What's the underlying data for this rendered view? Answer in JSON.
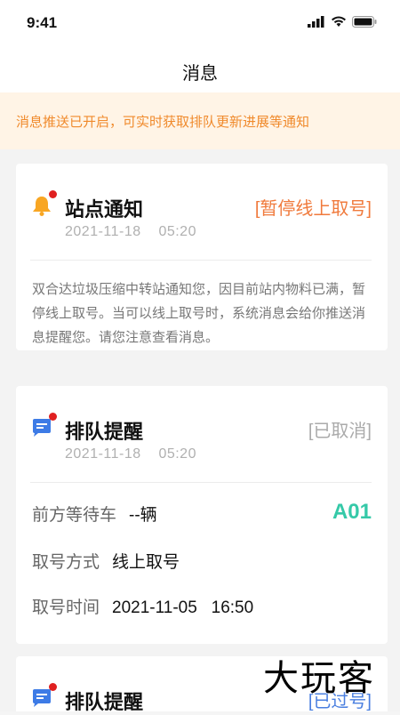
{
  "status_bar": {
    "time": "9:41"
  },
  "header": {
    "title": "消息"
  },
  "notice": {
    "text": "消息推送已开启，可实时获取排队更新进展等通知"
  },
  "cards": [
    {
      "icon": "bell-icon",
      "title": "站点通知",
      "tag": "[暂停线上取号]",
      "tag_color": "#f07a3c",
      "date": "2021-11-18    05:20",
      "body": "双合达垃圾压缩中转站通知您，因目前站内物料已满，暂停线上取号。当可以线上取号时，系统消息会给你推送消息提醒您。请您注意查看消息。"
    },
    {
      "icon": "chat-icon",
      "title": "排队提醒",
      "tag": "[已取消]",
      "tag_color": "#aaaaaa",
      "date": "2021-11-18    05:20",
      "rows": [
        {
          "label": "前方等待车",
          "value": "--辆"
        },
        {
          "label": "取号方式",
          "value": "线上取号"
        },
        {
          "label": "取号时间",
          "value": "2021-11-05   16:50"
        }
      ],
      "queue_code": "A01"
    },
    {
      "icon": "chat-icon",
      "title": "排队提醒",
      "tag": "[已过号]",
      "tag_color": "#4a7fe0"
    }
  ],
  "watermark": {
    "text": "大玩客"
  },
  "colors": {
    "accent_orange": "#f08a2c",
    "accent_green": "#35c9a8",
    "unread_dot": "#e02020"
  }
}
